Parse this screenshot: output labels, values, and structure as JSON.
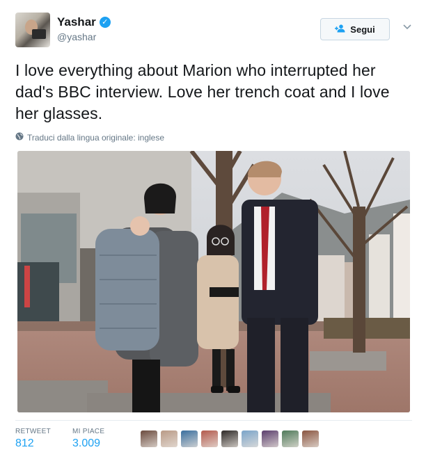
{
  "user": {
    "name": "Yashar",
    "handle": "@yashar",
    "verified_icon": "verified-badge-icon",
    "accent_color": "#1da1f2"
  },
  "follow": {
    "label": "Segui",
    "icon": "add-user-icon"
  },
  "tweet": {
    "text": "I love everything about Marion who interrupted her dad's BBC interview. Love her trench coat and I love her glasses."
  },
  "translate": {
    "label": "Traduci dalla lingua originale: inglese",
    "icon": "globe-icon"
  },
  "stats": {
    "retweets_label": "RETWEET",
    "retweets_value": "812",
    "likes_label": "MI PIACE",
    "likes_value": "3.009"
  },
  "likers": [
    {
      "color": "#6b4b3e"
    },
    {
      "color": "#b99a86"
    },
    {
      "color": "#3a6f9e"
    },
    {
      "color": "#b35a4c"
    },
    {
      "color": "#2e2a28"
    },
    {
      "color": "#7aa4c9"
    },
    {
      "color": "#5b3e6d"
    },
    {
      "color": "#4f7a5a"
    },
    {
      "color": "#8a5540"
    }
  ]
}
